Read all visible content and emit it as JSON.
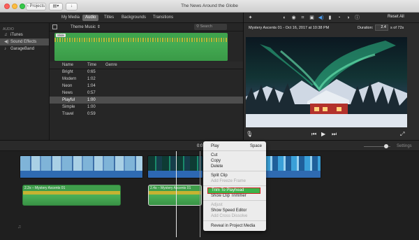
{
  "window": {
    "title": "The News Around the Globe",
    "projects_button": "Projects"
  },
  "browser_tabs": [
    "My Media",
    "Audio",
    "Titles",
    "Backgrounds",
    "Transitions"
  ],
  "sidebar": {
    "heading": "AUDIO",
    "items": [
      {
        "label": "iTunes",
        "icon": "music-note-icon"
      },
      {
        "label": "Sound Effects",
        "icon": "speaker-icon",
        "selected": true
      },
      {
        "label": "GarageBand",
        "icon": "guitar-icon"
      }
    ]
  },
  "audio_browser": {
    "theme_select": "Theme Music",
    "search_placeholder": "Search",
    "waveform_label": "Slide",
    "columns": [
      "Name",
      "Time",
      "Genre"
    ],
    "rows": [
      {
        "name": "Bright",
        "time": "0:65",
        "genre": ""
      },
      {
        "name": "Modern",
        "time": "1:02",
        "genre": ""
      },
      {
        "name": "Neon",
        "time": "1:04",
        "genre": ""
      },
      {
        "name": "News",
        "time": "0:57",
        "genre": ""
      },
      {
        "name": "Playful",
        "time": "1:00",
        "genre": "",
        "selected": true
      },
      {
        "name": "Simple",
        "time": "1:00",
        "genre": ""
      },
      {
        "name": "Travel",
        "time": "0:59",
        "genre": ""
      }
    ]
  },
  "viewer": {
    "reset_all": "Reset All",
    "clip_info": "Mystery Ascents 01 - Oct 16, 2017 at 10:38 PM",
    "duration_label": "Duration:",
    "duration_value": "2.4",
    "duration_of": "s of 72s"
  },
  "timeline": {
    "timecode": "0:0",
    "settings_label": "Settings",
    "audio_clips": [
      {
        "label": "2.2s – Mystery Ascents 01"
      },
      {
        "label": "2.4s – Mystery Ascents 01"
      }
    ]
  },
  "context_menu": {
    "items": [
      {
        "label": "Play",
        "shortcut": "Space",
        "enabled": true
      },
      {
        "label": "Cut",
        "enabled": true
      },
      {
        "label": "Copy",
        "enabled": true
      },
      {
        "label": "Delete",
        "enabled": true
      },
      {
        "label": "Split Clip",
        "enabled": true
      },
      {
        "label": "Add Freeze Frame",
        "enabled": false
      },
      {
        "label": "Trim To Playhead",
        "enabled": true,
        "highlighted": true
      },
      {
        "label": "Show Clip Trimmer",
        "enabled": true
      },
      {
        "label": "Adjust",
        "enabled": false
      },
      {
        "label": "Show Speed Editor",
        "enabled": true
      },
      {
        "label": "Add Cross Dissolve",
        "enabled": false
      },
      {
        "label": "Reveal in Project Media",
        "enabled": true
      }
    ]
  },
  "colors": {
    "accent_green": "#3cb34a",
    "highlight_border": "#d0201e",
    "selection_blue": "#4c9df1"
  }
}
